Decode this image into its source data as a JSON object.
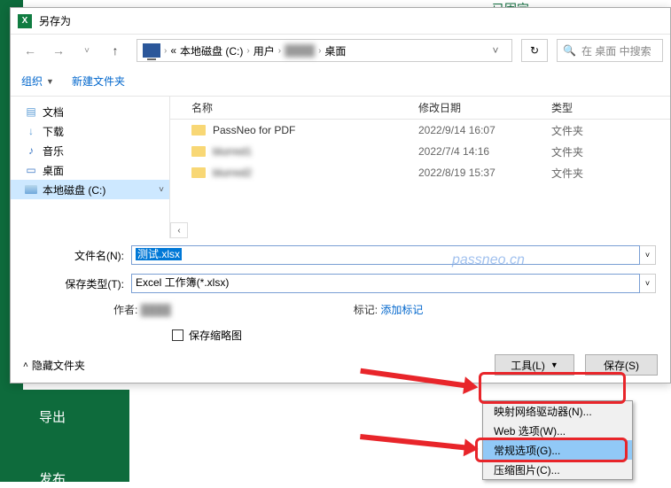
{
  "pinned_label": "已固定",
  "excel_menu": {
    "export": "导出",
    "publish": "发布"
  },
  "dialog": {
    "title": "另存为",
    "breadcrumb": {
      "c0": "«",
      "c1": "本地磁盘 (C:)",
      "c2": "用户",
      "c3_hidden": "████",
      "c4": "桌面"
    },
    "search_placeholder": "在 桌面 中搜索",
    "toolbar": {
      "organize": "组织",
      "newfolder": "新建文件夹"
    },
    "nav": {
      "docs": "文档",
      "downloads": "下载",
      "music": "音乐",
      "desktop": "桌面",
      "cdrive": "本地磁盘 (C:)"
    },
    "columns": {
      "name": "名称",
      "date": "修改日期",
      "type": "类型"
    },
    "rows": [
      {
        "name": "PassNeo for PDF",
        "date": "2022/9/14 16:07",
        "type": "文件夹",
        "blurred": false
      },
      {
        "name": "blurred1",
        "date": "2022/7/4 14:16",
        "type": "文件夹",
        "blurred": true
      },
      {
        "name": "blurred2",
        "date": "2022/8/19 15:37",
        "type": "文件夹",
        "blurred": true
      }
    ],
    "form": {
      "filename_label": "文件名(N):",
      "filename_value": "测试.xlsx",
      "savetype_label": "保存类型(T):",
      "savetype_value": "Excel 工作簿(*.xlsx)",
      "author_label": "作者:",
      "tags_label": "标记:",
      "tags_link": "添加标记",
      "thumbnail_label": "保存缩略图"
    },
    "footer": {
      "hide_folders": "隐藏文件夹",
      "tools": "工具(L)",
      "save": "保存(S)"
    }
  },
  "tools_menu": {
    "map_drive": "映射网络驱动器(N)...",
    "web_options": "Web 选项(W)...",
    "general_options": "常规选项(G)...",
    "compress_pics": "压缩图片(C)..."
  },
  "watermark": "passneo.cn"
}
